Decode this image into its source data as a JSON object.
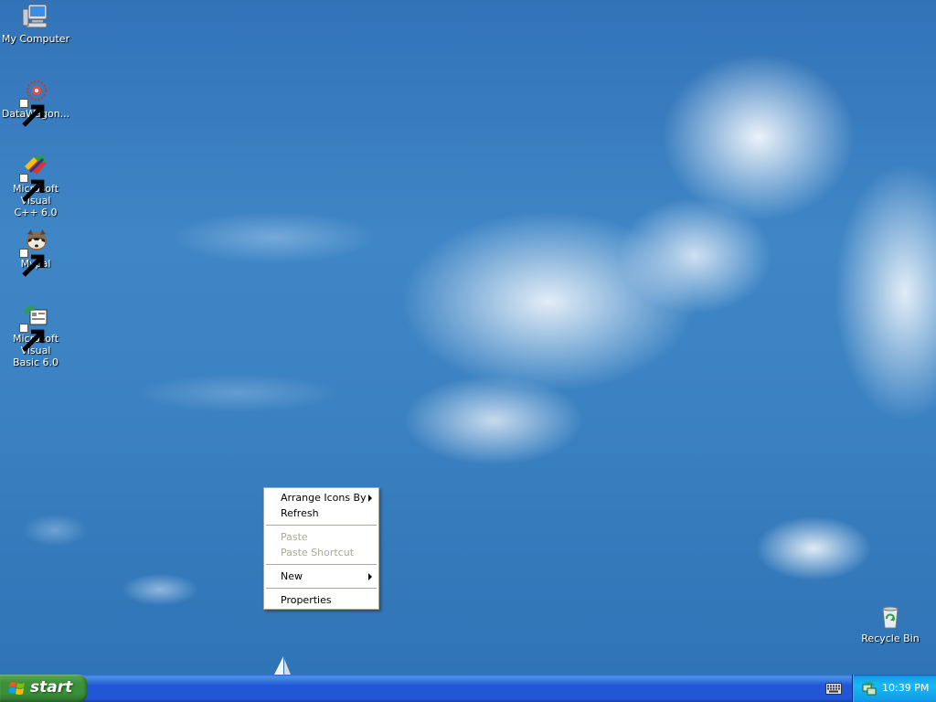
{
  "desktop": {
    "icons": [
      {
        "label": "My Computer",
        "icon": "my-computer-icon",
        "shortcut": false
      },
      {
        "label": "DataWagon...",
        "icon": "datawagon-icon",
        "shortcut": true
      },
      {
        "label": "Microsoft Visual\nC++ 6.0",
        "icon": "visual-cpp-icon",
        "shortcut": true
      },
      {
        "label": "Mypal",
        "icon": "mypal-icon",
        "shortcut": true
      },
      {
        "label": "Microsoft Visual\nBasic 6.0",
        "icon": "visual-basic-icon",
        "shortcut": true
      },
      {
        "label": "Recycle Bin",
        "icon": "recycle-bin-icon",
        "shortcut": false
      }
    ]
  },
  "context_menu": {
    "items": [
      {
        "label": "Arrange Icons By",
        "submenu": true,
        "enabled": true
      },
      {
        "label": "Refresh",
        "submenu": false,
        "enabled": true
      },
      {
        "label": "Paste",
        "submenu": false,
        "enabled": false
      },
      {
        "label": "Paste Shortcut",
        "submenu": false,
        "enabled": false
      },
      {
        "label": "New",
        "submenu": true,
        "enabled": true
      },
      {
        "label": "Properties",
        "submenu": false,
        "enabled": true
      }
    ]
  },
  "taskbar": {
    "start_label": "start",
    "tray": {
      "clock": "10:39 PM",
      "icons": [
        "keyboard-icon",
        "network-icon"
      ]
    }
  },
  "colors": {
    "desktop_sky": "#3b82c2",
    "taskbar_blue": "#2157d7",
    "start_green": "#3c8f3b",
    "tray_blue": "#139ee9",
    "menu_disabled": "#aca899"
  }
}
